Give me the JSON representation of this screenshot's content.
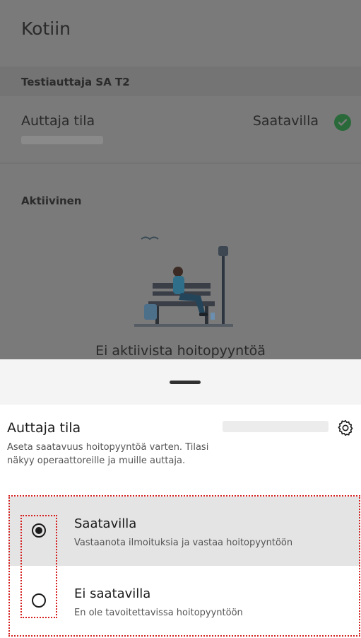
{
  "background": {
    "app_title": "Kotiin",
    "helper_name": "Testiauttaja SA T2",
    "status_label": "Auttaja tila",
    "status_value": "Saatavilla",
    "section_title": "Aktiivinen",
    "empty_state": "Ei aktiivista hoitopyyntöä"
  },
  "sheet": {
    "title": "Auttaja tila",
    "description": "Aseta saatavuus hoitopyyntöä varten. Tilasi näkyy operaattoreille ja muille auttaja.",
    "settings_icon": "gear-icon",
    "options": [
      {
        "label": "Saatavilla",
        "sublabel": "Vastaanota ilmoituksia ja vastaa hoitopyyntöön",
        "selected": true
      },
      {
        "label": "Ei saatavilla",
        "sublabel": "En ole tavoitettavissa hoitopyyntöön",
        "selected": false
      }
    ]
  },
  "colors": {
    "annotation": "#d62020",
    "status_ok": "#2e9d4f",
    "scrim": "#7a7a7a"
  }
}
